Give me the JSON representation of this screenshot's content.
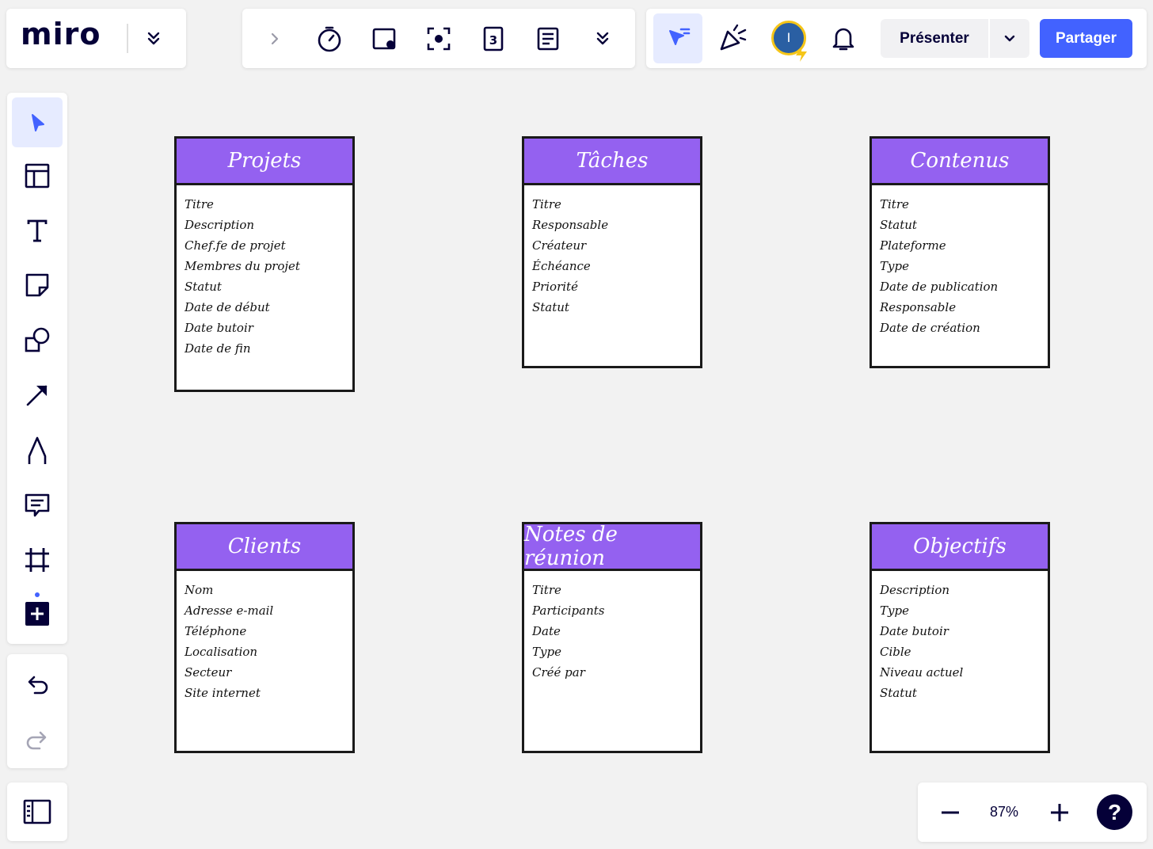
{
  "app": {
    "logo": "miro"
  },
  "collab": {
    "avatar_initial": "I",
    "present_label": "Présenter",
    "share_label": "Partager"
  },
  "zoom": {
    "level": "87%"
  },
  "help": {
    "label": "?"
  },
  "colors": {
    "accent": "#4262ff",
    "card_header": "#9461f0",
    "canvas": "#f2f2f2",
    "ink": "#050038"
  },
  "icons": {
    "logo_panel": [
      "chevron-double-down-icon"
    ],
    "tools": [
      "chevron-right-icon",
      "timer-icon",
      "card-icon",
      "focus-icon",
      "voting-icon",
      "notes-icon",
      "chevron-double-down-icon"
    ],
    "collab": [
      "cursor-reactions-icon",
      "celebrate-icon",
      "bell-icon",
      "chevron-down-icon"
    ],
    "left_toolbar": [
      "select-icon",
      "templates-icon",
      "text-icon",
      "sticky-note-icon",
      "shapes-icon",
      "arrow-icon",
      "pen-icon",
      "comment-icon",
      "frame-icon",
      "add-apps-icon"
    ],
    "history": [
      "undo-icon",
      "redo-icon"
    ],
    "boards": [
      "board-list-icon"
    ],
    "zoom": [
      "zoom-out-icon",
      "zoom-in-icon"
    ]
  },
  "cards": [
    {
      "title": "Projets",
      "fields": [
        "Titre",
        "Description",
        "Chef.fe de projet",
        "Membres du projet",
        "Statut",
        "Date de début",
        "Date butoir",
        "Date de fin"
      ]
    },
    {
      "title": "Tâches",
      "fields": [
        "Titre",
        "Responsable",
        "Créateur",
        "Échéance",
        "Priorité",
        "Statut"
      ]
    },
    {
      "title": "Contenus",
      "fields": [
        "Titre",
        "Statut",
        "Plateforme",
        "Type",
        "Date de publication",
        "Responsable",
        "Date de création"
      ]
    },
    {
      "title": "Clients",
      "fields": [
        "Nom",
        "Adresse e-mail",
        "Téléphone",
        "Localisation",
        "Secteur",
        "Site internet"
      ]
    },
    {
      "title": "Notes de réunion",
      "fields": [
        "Titre",
        "Participants",
        "Date",
        "Type",
        "Créé par"
      ]
    },
    {
      "title": "Objectifs",
      "fields": [
        "Description",
        "Type",
        "Date butoir",
        "Cible",
        "Niveau actuel",
        "Statut"
      ]
    }
  ]
}
